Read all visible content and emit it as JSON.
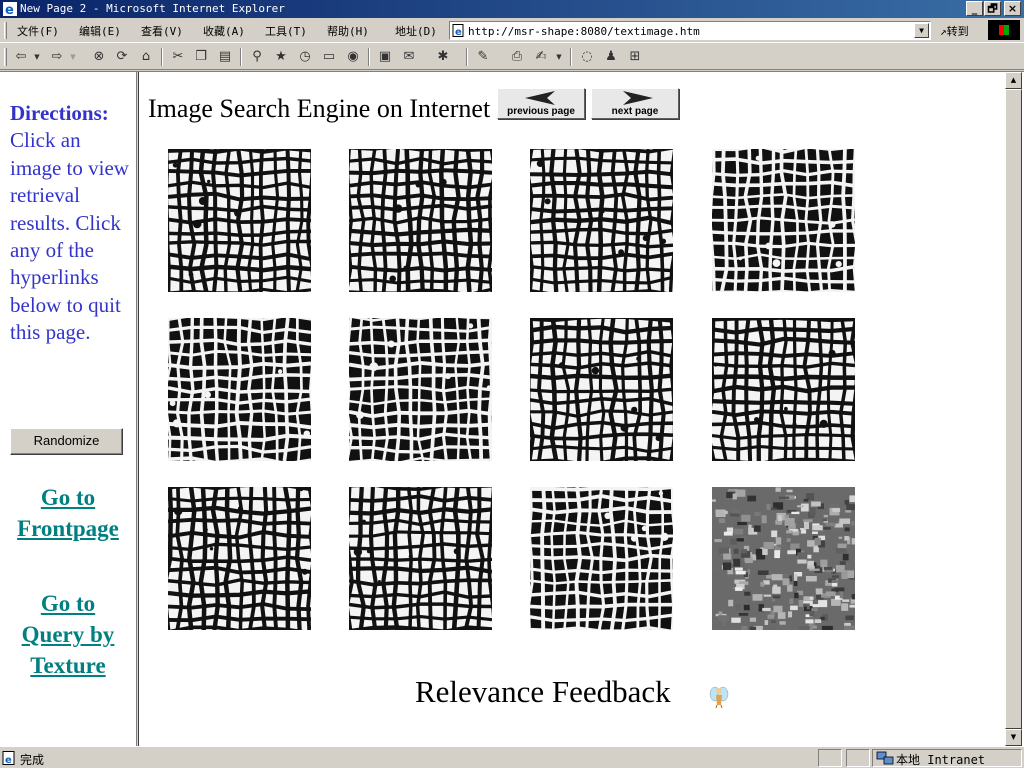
{
  "window": {
    "title": "New Page 2 - Microsoft Internet Explorer",
    "minimize_label": "_",
    "restore_label": "🗗",
    "close_label": "×"
  },
  "menu": {
    "items": [
      "文件(F)",
      "编辑(E)",
      "查看(V)",
      "收藏(A)",
      "工具(T)",
      "帮助(H)"
    ],
    "address_label": "地址(D)",
    "url": "http://msr-shape:8080/textimage.htm",
    "go_label": "转到"
  },
  "toolbar": {
    "icons": [
      "back-icon",
      "forward-icon",
      "stop-icon",
      "refresh-icon",
      "home-icon",
      "cut-icon",
      "copy-icon",
      "paste-icon",
      "search-icon",
      "favorites-icon",
      "history-icon",
      "folder-icon",
      "media-icon",
      "fullscreen-icon",
      "mail-icon",
      "translate-icon",
      "edit-icon",
      "print-icon",
      "compose-icon",
      "discuss-icon",
      "messenger-icon",
      "research-icon"
    ]
  },
  "left_frame": {
    "directions_title": "Directions:",
    "directions_text": "Click an image to view retrieval results. Click any of the hyperlinks below to quit this page.",
    "randomize_label": "Randomize",
    "link_frontpage_line1": "Go to",
    "link_frontpage_line2": "Frontpage",
    "link_texture_line1": "Go to",
    "link_texture_line2": "Query by",
    "link_texture_line3": "Texture"
  },
  "main": {
    "heading": "Image Search Engine on Internet",
    "prev_label": "previous page",
    "next_label": "next page",
    "thumbnails": [
      {
        "style": "light-grid",
        "seed": 3
      },
      {
        "style": "light-grid",
        "seed": 7
      },
      {
        "style": "light-grid",
        "seed": 11
      },
      {
        "style": "dark-grid",
        "seed": 5
      },
      {
        "style": "dark-grid",
        "seed": 13
      },
      {
        "style": "dark-grid",
        "seed": 17
      },
      {
        "style": "light-grid",
        "seed": 19
      },
      {
        "style": "light-grid",
        "seed": 23
      },
      {
        "style": "light-grid",
        "seed": 29
      },
      {
        "style": "light-grid",
        "seed": 31
      },
      {
        "style": "dark-grid",
        "seed": 37
      },
      {
        "style": "rough-texture",
        "seed": 41
      }
    ],
    "feedback_label": "Relevance Feedback"
  },
  "status": {
    "text": "完成",
    "zone": "本地 Intranet"
  }
}
